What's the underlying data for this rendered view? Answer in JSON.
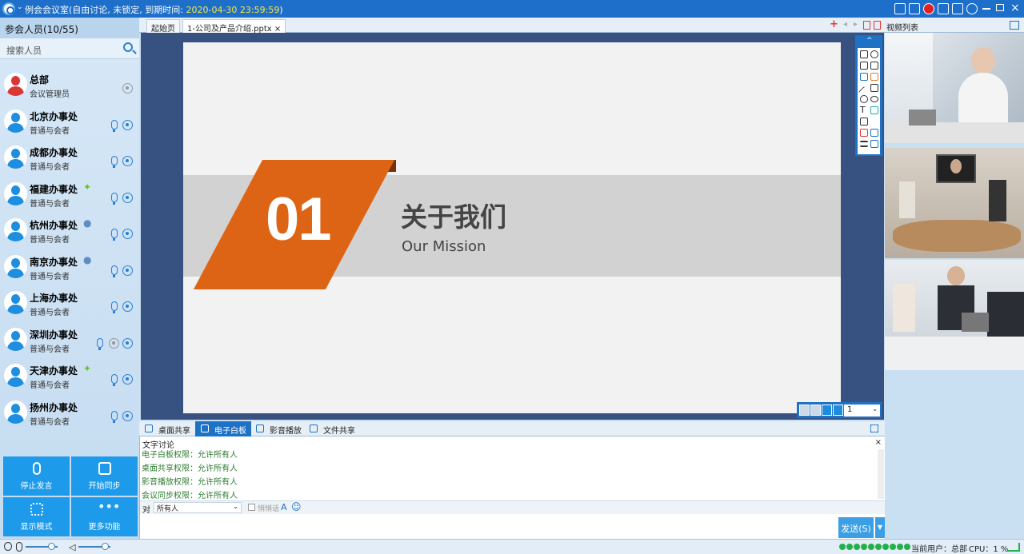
{
  "titlebar": {
    "title": "例会会议室(自由讨论, 未锁定, 到期时间: ",
    "expiry": "2020-04-30 23:59:59",
    "close_paren": ")"
  },
  "participants": {
    "header": "参会人员(10/55)",
    "search_placeholder": "搜索人员",
    "members": [
      {
        "name": "总部",
        "role": "会议管理员",
        "os": ""
      },
      {
        "name": "北京办事处",
        "role": "普通与会者",
        "os": ""
      },
      {
        "name": "成都办事处",
        "role": "普通与会者",
        "os": ""
      },
      {
        "name": "福建办事处",
        "role": "普通与会者",
        "os": "android"
      },
      {
        "name": "杭州办事处",
        "role": "普通与会者",
        "os": "apple"
      },
      {
        "name": "南京办事处",
        "role": "普通与会者",
        "os": "apple"
      },
      {
        "name": "上海办事处",
        "role": "普通与会者",
        "os": ""
      },
      {
        "name": "深圳办事处",
        "role": "普通与会者",
        "os": ""
      },
      {
        "name": "天津办事处",
        "role": "普通与会者",
        "os": "android"
      },
      {
        "name": "扬州办事处",
        "role": "普通与会者",
        "os": ""
      }
    ]
  },
  "actions": {
    "stop_speak": "停止发言",
    "start_sync": "开始同步",
    "display_mode": "显示模式",
    "more": "更多功能"
  },
  "tabs": {
    "home": "起始页",
    "doc": "1-公司及产品介绍.pptx",
    "doc_close": "×"
  },
  "slide": {
    "number": "01",
    "title": "关于我们",
    "subtitle": "Our Mission"
  },
  "pager": {
    "page": "1"
  },
  "video": {
    "header": "视频列表"
  },
  "bottom_tabs": {
    "desktop": "桌面共享",
    "whiteboard": "电子白板",
    "media": "影音播放",
    "file": "文件共享"
  },
  "chat": {
    "title": "文字讨论",
    "close": "×",
    "lines": [
      "电子白板权限：允许所有人",
      "桌面共享权限：允许所有人",
      "影音播放权限：允许所有人",
      "会议同步权限：允许所有人"
    ],
    "to_label": "对",
    "to_value": "所有人",
    "private_label": "悄悄话",
    "font_glyph": "A",
    "emoji_glyph": "☺",
    "send": "发送(S)"
  },
  "status": {
    "current_user": "当前用户：总部",
    "cpu": "CPU：1 %"
  },
  "colors": {
    "accent": "#1d72c6",
    "slide_orange": "#de6415",
    "chat_green": "#2e7d32"
  }
}
